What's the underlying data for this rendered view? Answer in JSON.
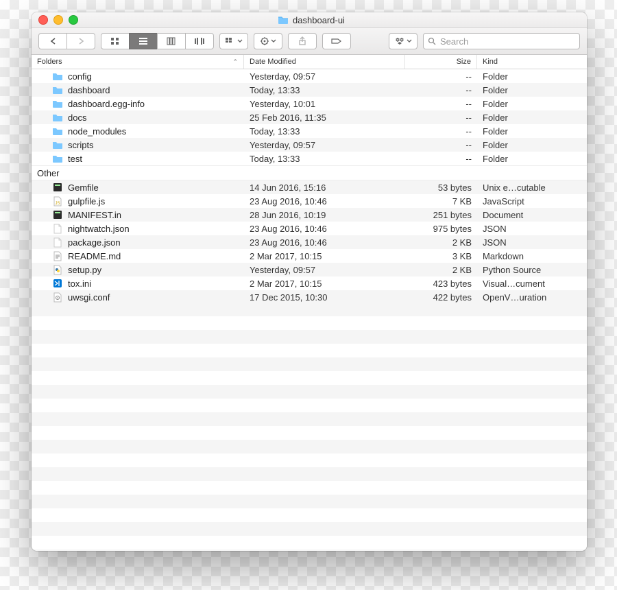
{
  "window": {
    "title": "dashboard-ui"
  },
  "search": {
    "placeholder": "Search"
  },
  "columns": {
    "name": "Folders",
    "date": "Date Modified",
    "size": "Size",
    "kind": "Kind"
  },
  "groups": [
    {
      "label": "Folders",
      "items": [
        {
          "icon": "folder",
          "name": "config",
          "date": "Yesterday, 09:57",
          "size": "--",
          "kind": "Folder"
        },
        {
          "icon": "folder",
          "name": "dashboard",
          "date": "Today, 13:33",
          "size": "--",
          "kind": "Folder"
        },
        {
          "icon": "folder",
          "name": "dashboard.egg-info",
          "date": "Yesterday, 10:01",
          "size": "--",
          "kind": "Folder"
        },
        {
          "icon": "folder",
          "name": "docs",
          "date": "25 Feb 2016, 11:35",
          "size": "--",
          "kind": "Folder"
        },
        {
          "icon": "folder",
          "name": "node_modules",
          "date": "Today, 13:33",
          "size": "--",
          "kind": "Folder"
        },
        {
          "icon": "folder",
          "name": "scripts",
          "date": "Yesterday, 09:57",
          "size": "--",
          "kind": "Folder"
        },
        {
          "icon": "folder",
          "name": "test",
          "date": "Today, 13:33",
          "size": "--",
          "kind": "Folder"
        }
      ]
    },
    {
      "label": "Other",
      "items": [
        {
          "icon": "exec",
          "name": "Gemfile",
          "date": "14 Jun 2016, 15:16",
          "size": "53 bytes",
          "kind": "Unix e…cutable"
        },
        {
          "icon": "js",
          "name": "gulpfile.js",
          "date": "23 Aug 2016, 10:46",
          "size": "7 KB",
          "kind": "JavaScript"
        },
        {
          "icon": "exec",
          "name": "MANIFEST.in",
          "date": "28 Jun 2016, 10:19",
          "size": "251 bytes",
          "kind": "Document"
        },
        {
          "icon": "blank",
          "name": "nightwatch.json",
          "date": "23 Aug 2016, 10:46",
          "size": "975 bytes",
          "kind": "JSON"
        },
        {
          "icon": "blank",
          "name": "package.json",
          "date": "23 Aug 2016, 10:46",
          "size": "2 KB",
          "kind": "JSON"
        },
        {
          "icon": "text",
          "name": "README.md",
          "date": "2 Mar 2017, 10:15",
          "size": "3 KB",
          "kind": "Markdown"
        },
        {
          "icon": "py",
          "name": "setup.py",
          "date": "Yesterday, 09:57",
          "size": "2 KB",
          "kind": "Python Source"
        },
        {
          "icon": "vs",
          "name": "tox.ini",
          "date": "2 Mar 2017, 10:15",
          "size": "423 bytes",
          "kind": "Visual…cument"
        },
        {
          "icon": "conf",
          "name": "uwsgi.conf",
          "date": "17 Dec 2015, 10:30",
          "size": "422 bytes",
          "kind": "OpenV…uration"
        }
      ]
    }
  ]
}
